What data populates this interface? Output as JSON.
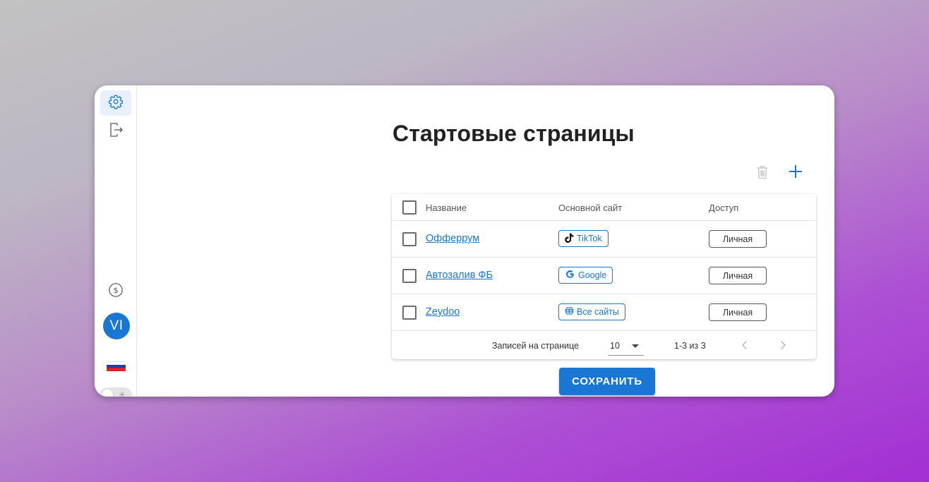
{
  "sidebar": {
    "items": [
      {
        "name": "settings",
        "icon": "gear-icon",
        "active": true
      },
      {
        "name": "logout",
        "icon": "logout-icon",
        "active": false
      }
    ],
    "balance_icon": "dollar-circle-icon",
    "avatar_initials": "VI",
    "language_flag": "ru-flag",
    "theme_toggle_icon": "sun-icon"
  },
  "page": {
    "title": "Стартовые страницы"
  },
  "toolbar": {
    "delete_icon": "trash-icon",
    "add_icon": "plus-icon"
  },
  "table": {
    "columns": [
      "Название",
      "Основной сайт",
      "Доступ"
    ],
    "rows": [
      {
        "name": "Офферрум",
        "site": "TikTok",
        "site_icon": "tiktok-icon",
        "access": "Личная"
      },
      {
        "name": "Автозалив ФБ",
        "site": "Google",
        "site_icon": "google-icon",
        "access": "Личная"
      },
      {
        "name": "Zeydoo",
        "site": "Все сайты",
        "site_icon": "globe-icon",
        "access": "Личная"
      }
    ]
  },
  "pagination": {
    "rows_per_page_label": "Записей на странице",
    "rows_per_page_value": "10",
    "range": "1-3 из 3"
  },
  "actions": {
    "save_label": "СОХРАНИТЬ"
  },
  "colors": {
    "accent": "#1976d2",
    "active_nav_bg": "#e8f1fb"
  }
}
